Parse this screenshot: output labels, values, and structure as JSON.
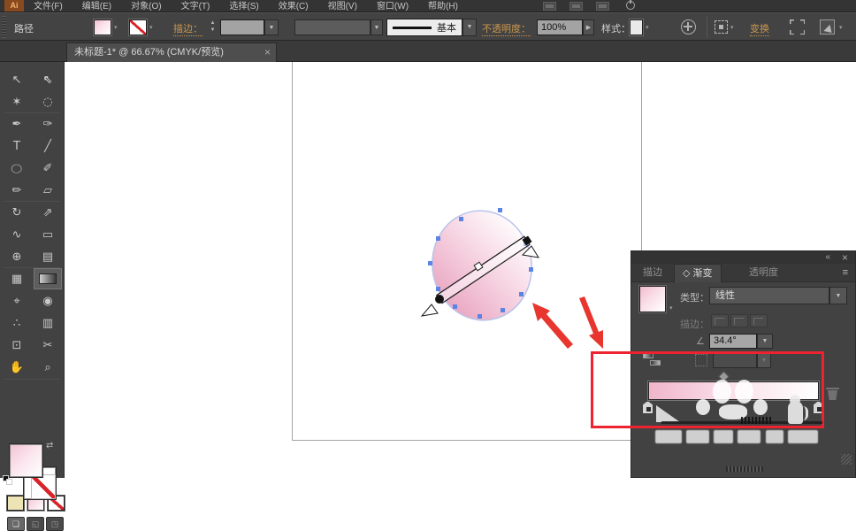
{
  "app": {
    "logo_text": "Ai"
  },
  "menu": {
    "items": [
      {
        "label": "文件(F)"
      },
      {
        "label": "编辑(E)"
      },
      {
        "label": "对象(O)"
      },
      {
        "label": "文字(T)"
      },
      {
        "label": "选择(S)"
      },
      {
        "label": "效果(C)"
      },
      {
        "label": "视图(V)"
      },
      {
        "label": "窗口(W)"
      },
      {
        "label": "帮助(H)"
      }
    ]
  },
  "control_bar": {
    "selection_type": "路径",
    "stroke_link": "描边：",
    "style_value": "基本",
    "opacity_link": "不透明度：",
    "opacity_value": "100%",
    "style_label": "样式：",
    "transform_link": "变换"
  },
  "doc_tab": {
    "title": "未标题-1* @ 66.67% (CMYK/预览)"
  },
  "toolbar": {
    "tools": [
      {
        "name": "selection-tool",
        "glyph": "↖"
      },
      {
        "name": "direct-selection-tool",
        "glyph": "⇖"
      },
      {
        "name": "magic-wand-tool",
        "glyph": "✶"
      },
      {
        "name": "lasso-tool",
        "glyph": "◌"
      },
      {
        "name": "pen-tool",
        "glyph": "✒"
      },
      {
        "name": "brush-pen-tool",
        "glyph": "✑"
      },
      {
        "name": "type-tool",
        "glyph": "T"
      },
      {
        "name": "line-segment-tool",
        "glyph": "╱"
      },
      {
        "name": "ellipse-tool",
        "glyph": "○"
      },
      {
        "name": "paintbrush-tool",
        "glyph": "✐"
      },
      {
        "name": "pencil-tool",
        "glyph": "✏"
      },
      {
        "name": "eraser-tool",
        "glyph": "▱"
      },
      {
        "name": "rotate-tool",
        "glyph": "↻"
      },
      {
        "name": "scale-tool",
        "glyph": "⇗"
      },
      {
        "name": "width-tool",
        "glyph": "∿"
      },
      {
        "name": "free-transform-tool",
        "glyph": "▭"
      },
      {
        "name": "shape-builder-tool",
        "glyph": "⊕"
      },
      {
        "name": "perspective-grid-tool",
        "glyph": "▤"
      },
      {
        "name": "mesh-tool",
        "glyph": "▦"
      },
      {
        "name": "gradient-tool",
        "glyph": ""
      },
      {
        "name": "eyedropper-tool",
        "glyph": "⌖"
      },
      {
        "name": "blend-tool",
        "glyph": "◉"
      },
      {
        "name": "symbol-sprayer-tool",
        "glyph": "∴"
      },
      {
        "name": "column-graph-tool",
        "glyph": "▥"
      },
      {
        "name": "artboard-tool",
        "glyph": "⊡"
      },
      {
        "name": "slice-tool",
        "glyph": "✂"
      },
      {
        "name": "hand-tool",
        "glyph": "✋"
      },
      {
        "name": "zoom-tool",
        "glyph": "⌕"
      }
    ]
  },
  "gradient_panel": {
    "tabs": {
      "stroke": "描边",
      "gradient": "渐变",
      "transparency": "透明度"
    },
    "type_label": "类型：",
    "type_value": "线性",
    "stroke_label": "描边：",
    "angle_value": "34.4°",
    "gradient_start_color": "#f0b5ca",
    "gradient_end_color": "#ffffff"
  },
  "canvas": {
    "ellipse_fill_start": "#e9a6c1",
    "ellipse_fill_end": "#ffffff",
    "anchor_color": "#5b84e4"
  },
  "annotation": {
    "color": "#ed2330"
  },
  "icons": {
    "caret": "▼",
    "caret_small": "▾",
    "play": "▶",
    "up": "▲",
    "down": "▼",
    "angle": "∠",
    "diamond": "◇",
    "panel_menu": "≡",
    "collapse": "«",
    "close": "×",
    "swap": "⇄"
  }
}
